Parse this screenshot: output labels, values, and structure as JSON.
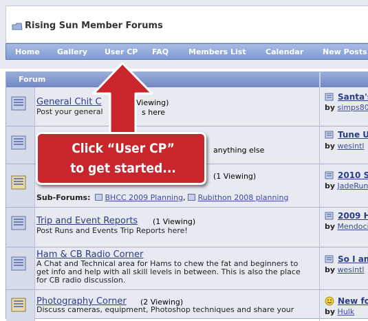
{
  "header": {
    "title": "Rising Sun Member Forums"
  },
  "nav": [
    {
      "label": "Home"
    },
    {
      "label": "Gallery"
    },
    {
      "label": "User CP"
    },
    {
      "label": "FAQ"
    },
    {
      "label": "Members List"
    },
    {
      "label": "Calendar"
    },
    {
      "label": "New Posts"
    }
  ],
  "table": {
    "header": "Forum"
  },
  "forums": [
    {
      "title": "General Chit C",
      "views": "Viewing)",
      "desc": "Post your general ",
      "desc2": "s here",
      "last_title": "Santa's",
      "last_by": "simps80"
    },
    {
      "title": "",
      "views": "",
      "desc": "anything else",
      "last_title": "Tune U",
      "last_by": "wesintl"
    },
    {
      "title": "",
      "views": "(1 Viewing)",
      "desc": "",
      "last_title": "2010 S",
      "last_by": "JadeRun"
    },
    {
      "title": "Trip and Event Reports",
      "views": "(1 Viewing)",
      "desc": "Post Runs and Events Trip Reports here!",
      "last_title": "2009 H",
      "last_by": "Mendoci"
    },
    {
      "title": "Ham & CB Radio Corner",
      "views": "",
      "desc": "A Chat and Technical area for Hams to chew the fat and beginners to get info and help with all skill levels in between. This is also the place for CB radio discussion.",
      "last_title": "So I am",
      "last_by": "wesintl"
    },
    {
      "title": "Photography Corner",
      "views": "(2 Viewing)",
      "desc": "Discuss cameras, equipment, Photoshop techniques and share your",
      "last_title": "New fo",
      "last_by": "Hulk"
    }
  ],
  "subforums": {
    "label": "Sub-Forums",
    "items": [
      "BHCC 2009 Planning",
      "Rubithon 2008 planning"
    ]
  },
  "last_by_prefix": "by",
  "callout": {
    "line1": "Click “User CP”",
    "line2": "to get started..."
  },
  "colors": {
    "accent": "#c9252c",
    "nav": "#7f9bd4",
    "link": "#2d3a8a"
  }
}
